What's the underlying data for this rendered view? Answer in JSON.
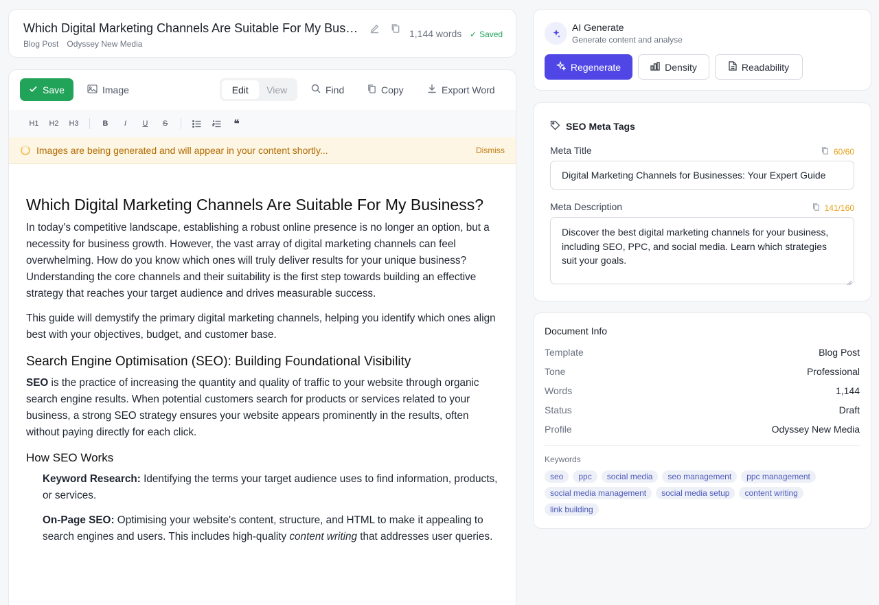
{
  "header": {
    "title": "Which Digital Marketing Channels Are Suitable For My Business?",
    "template": "Blog Post",
    "profile": "Odyssey New Media",
    "word_count": "1,144 words",
    "saved": "Saved",
    "edit_icon": "pencil-icon",
    "copy_icon": "copy-icon"
  },
  "toolbar": {
    "save": "Save",
    "image": "Image",
    "edit": "Edit",
    "view": "View",
    "find": "Find",
    "copy": "Copy",
    "export": "Export Word"
  },
  "format_bar": [
    "H1",
    "H2",
    "H3",
    "B",
    "I",
    "U",
    "S",
    "bullet-list",
    "numbered-list",
    "quote"
  ],
  "notice": {
    "text": "Images are being generated and will appear in your content shortly...",
    "dismiss": "Dismiss"
  },
  "article": {
    "h1": "Which Digital Marketing Channels Are Suitable For My Business?",
    "p1": "In today's competitive landscape, establishing a robust online presence is no longer an option, but a necessity for business growth. However, the vast array of digital marketing channels can feel overwhelming. How do you know which ones will truly deliver results for your unique business? Understanding the core channels and their suitability is the first step towards building an effective strategy that reaches your target audience and drives measurable success.",
    "p2": "This guide will demystify the primary digital marketing channels, helping you identify which ones align best with your objectives, budget, and customer base.",
    "h2": "Search Engine Optimisation (SEO): Building Foundational Visibility",
    "p3_bold": "SEO",
    "p3_rest": " is the practice of increasing the quantity and quality of traffic to your website through organic search engine results. When potential customers search for products or services related to your business, a strong SEO strategy ensures your website appears prominently in the results, often without paying directly for each click.",
    "h3": "How SEO Works",
    "item1_bold": "Keyword Research:",
    "item1_rest": " Identifying the terms your target audience uses to find information, products, or services.",
    "item2_bold": "On-Page SEO:",
    "item2_mid": " Optimising your website's content, structure, and HTML to make it appealing to search engines and users. This includes high-quality ",
    "item2_italic": "content writing",
    "item2_end": " that addresses user queries."
  },
  "ai": {
    "title": "AI Generate",
    "subtitle": "Generate content and analyse",
    "regenerate": "Regenerate",
    "density": "Density",
    "readability": "Readability"
  },
  "seo": {
    "heading": "SEO Meta Tags",
    "meta_title_label": "Meta Title",
    "meta_title_count": "60/60",
    "meta_title_value": "Digital Marketing Channels for Businesses: Your Expert Guide",
    "meta_desc_label": "Meta Description",
    "meta_desc_count": "141/160",
    "meta_desc_value": "Discover the best digital marketing channels for your business, including SEO, PPC, and social media. Learn which strategies suit your goals."
  },
  "info": {
    "title": "Document Info",
    "rows": [
      {
        "k": "Template",
        "v": "Blog Post"
      },
      {
        "k": "Tone",
        "v": "Professional"
      },
      {
        "k": "Words",
        "v": "1,144"
      },
      {
        "k": "Status",
        "v": "Draft"
      },
      {
        "k": "Profile",
        "v": "Odyssey New Media"
      }
    ],
    "keywords_label": "Keywords",
    "keywords": [
      "seo",
      "ppc",
      "social media",
      "seo management",
      "ppc management",
      "social media management",
      "social media setup",
      "content writing",
      "link building"
    ]
  },
  "colors": {
    "save_green": "#22a35a",
    "accent_indigo": "#4f46e5",
    "warning_amber": "#e6a11c"
  }
}
